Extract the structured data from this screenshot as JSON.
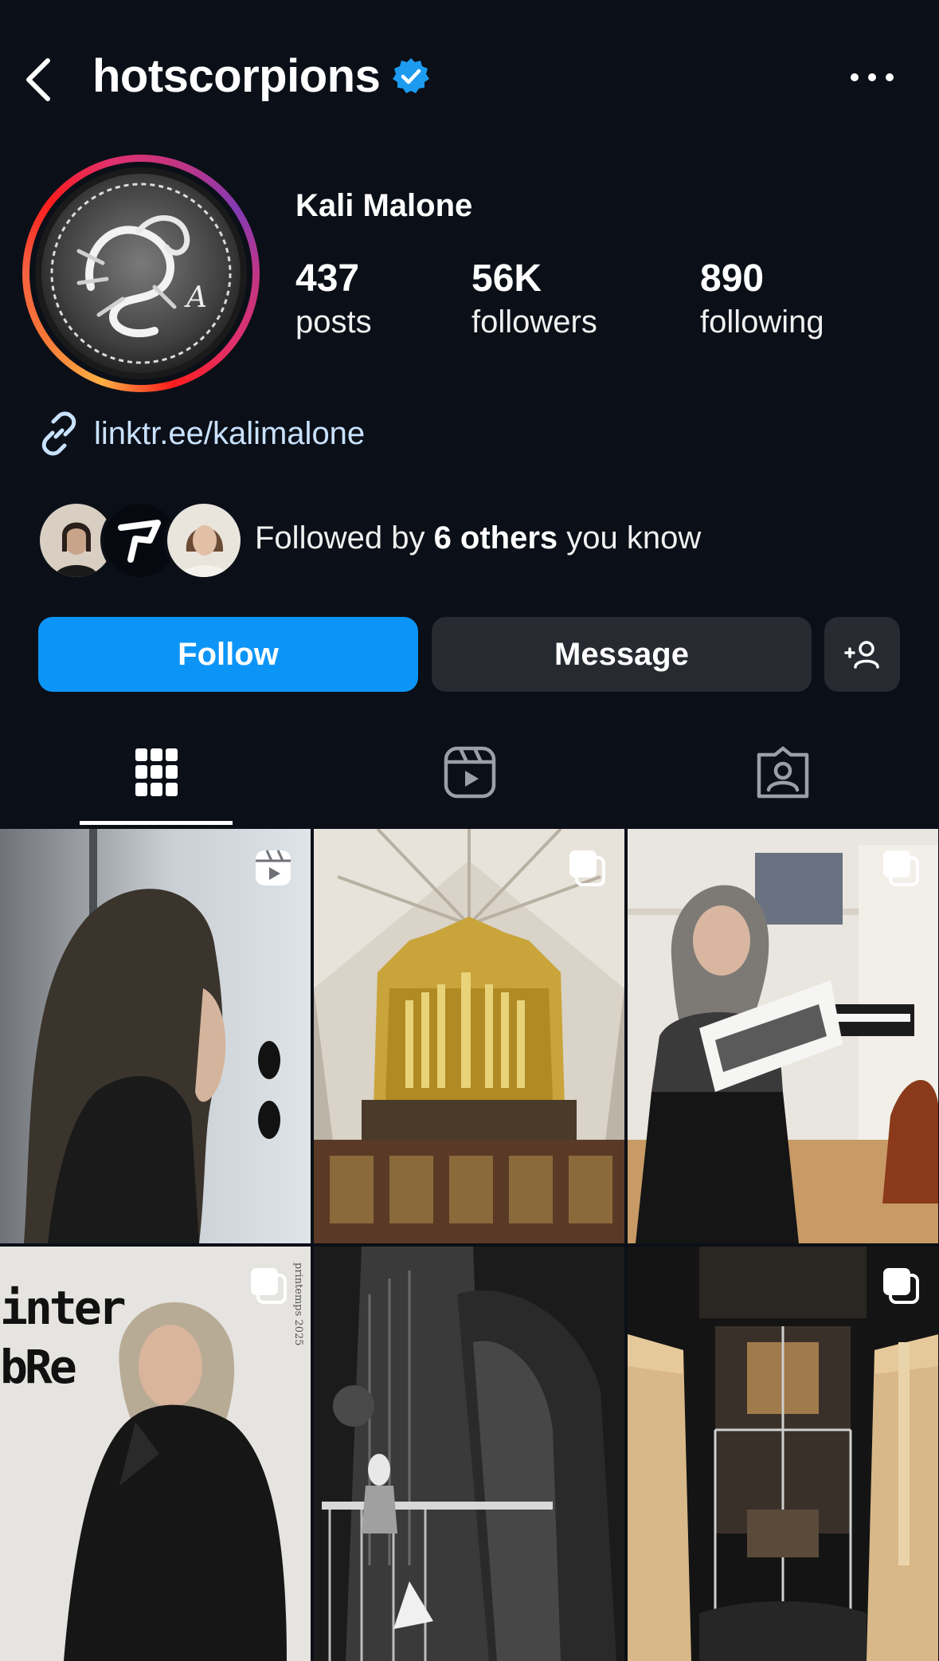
{
  "header": {
    "username": "hotscorpions",
    "verified": true,
    "back_icon": "chevron-left-icon",
    "more_icon": "more-horizontal-icon"
  },
  "profile": {
    "display_name": "Kali Malone",
    "stats": [
      {
        "value": "437",
        "label": "posts"
      },
      {
        "value": "56K",
        "label": "followers"
      },
      {
        "value": "890",
        "label": "following"
      }
    ],
    "link": "linktr.ee/kalimalone",
    "followed_by": {
      "prefix": "Followed by",
      "bold": "6 others",
      "suffix": "you know"
    }
  },
  "actions": {
    "follow": "Follow",
    "message": "Message",
    "suggest_icon": "add-person-icon"
  },
  "tabs": [
    {
      "name": "posts",
      "icon": "grid-icon",
      "active": true
    },
    {
      "name": "reels",
      "icon": "reels-icon",
      "active": false
    },
    {
      "name": "tagged",
      "icon": "tagged-icon",
      "active": false
    }
  ],
  "grid": {
    "post_4_magazine_text": "inter bRe",
    "post_4_side_text": "printemps 2025"
  },
  "colors": {
    "background": "#0b0f17",
    "accent_blue": "#0c95f7",
    "secondary_button": "#272a31",
    "verified_blue": "#1d9bf0",
    "link": "#c9e2ff"
  }
}
